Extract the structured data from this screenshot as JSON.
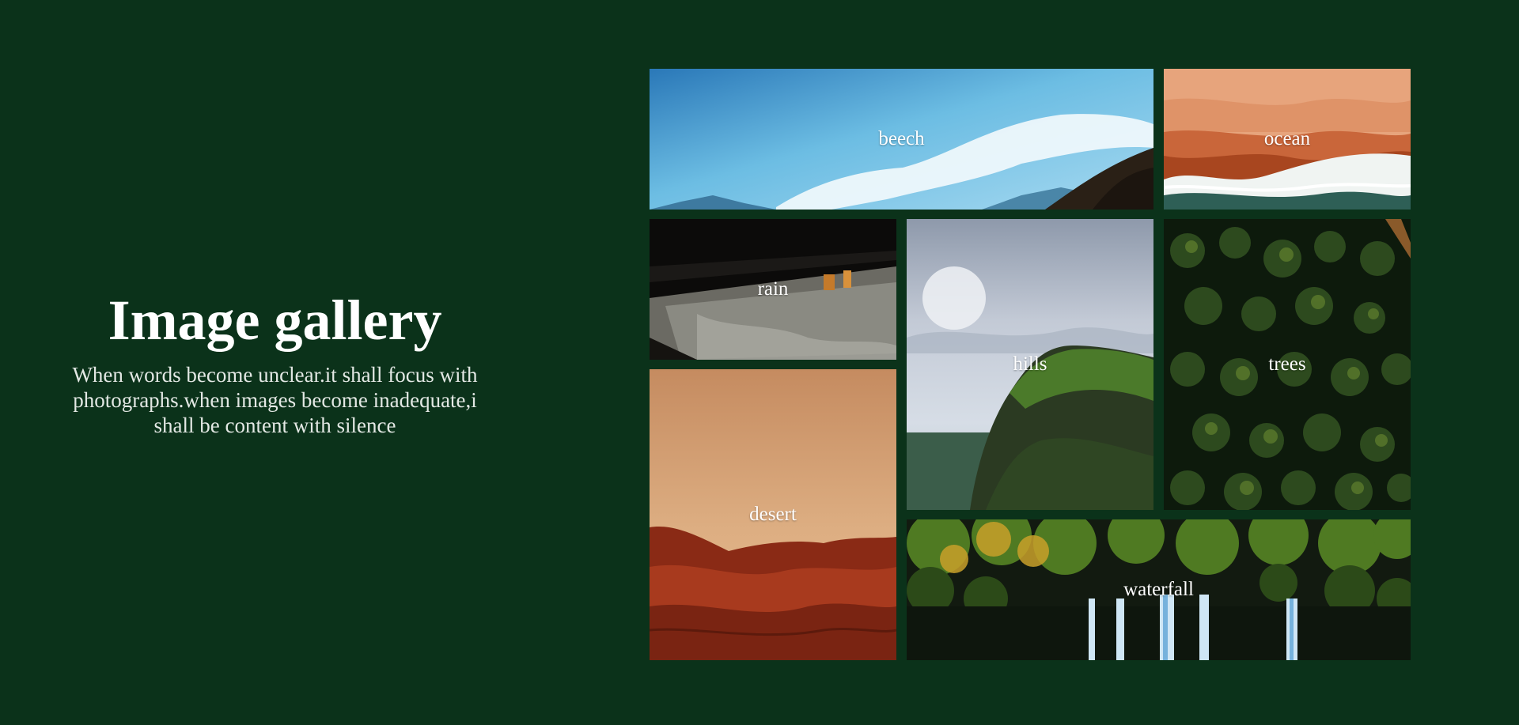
{
  "colors": {
    "background": "#0b321a",
    "text": "#ffffff"
  },
  "intro": {
    "title": "Image gallery",
    "description": "When words become unclear.it shall focus with photographs.when images become inadequate,i shall be content with silence"
  },
  "gallery": {
    "items": [
      {
        "label": "beech"
      },
      {
        "label": "ocean"
      },
      {
        "label": "rain"
      },
      {
        "label": "hills"
      },
      {
        "label": "trees"
      },
      {
        "label": "desert"
      },
      {
        "label": "waterfall"
      }
    ]
  }
}
